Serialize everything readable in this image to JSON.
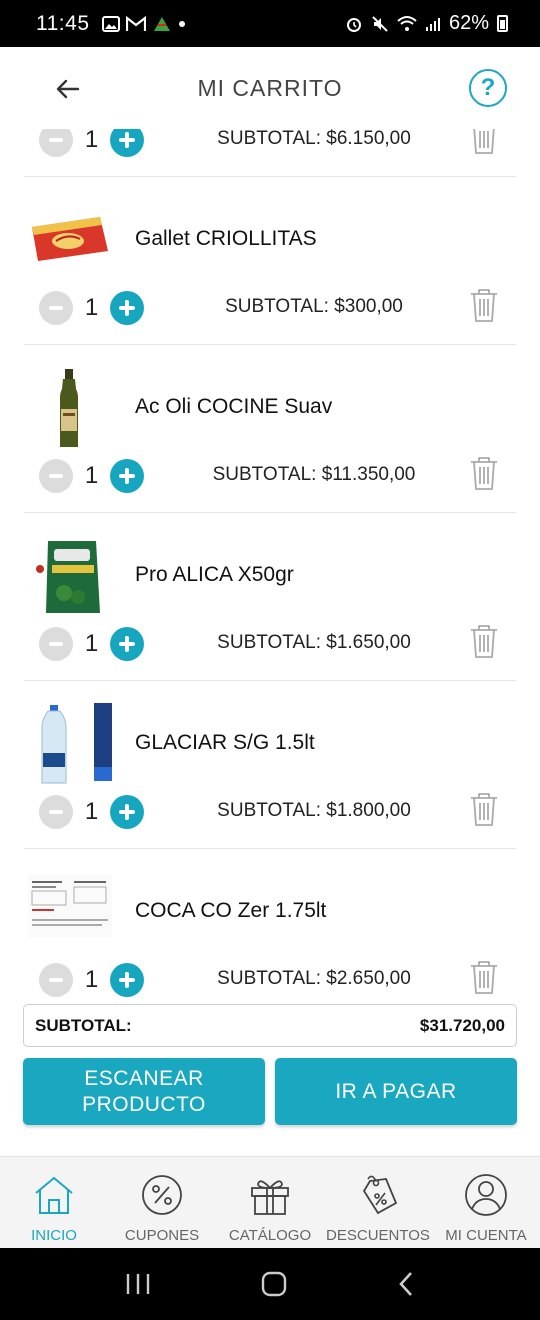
{
  "status_bar": {
    "time": "11:45",
    "battery": "62%"
  },
  "header": {
    "title": "MI CARRITO",
    "help": "?"
  },
  "cart": {
    "items": [
      {
        "name": "",
        "qty": "1",
        "subtotal": "SUBTOTAL: $6.150,00"
      },
      {
        "name": "Gallet CRIOLLITAS",
        "qty": "1",
        "subtotal": "SUBTOTAL: $300,00"
      },
      {
        "name": "Ac Oli COCINE Suav",
        "qty": "1",
        "subtotal": "SUBTOTAL: $11.350,00"
      },
      {
        "name": "Pro ALICA X50gr",
        "qty": "1",
        "subtotal": "SUBTOTAL: $1.650,00"
      },
      {
        "name": "GLACIAR S/G 1.5lt",
        "qty": "1",
        "subtotal": "SUBTOTAL: $1.800,00"
      },
      {
        "name": "COCA CO Zer 1.75lt",
        "qty": "1",
        "subtotal": "SUBTOTAL: $2.650,00"
      }
    ]
  },
  "totals": {
    "label": "SUBTOTAL:",
    "value": "$31.720,00"
  },
  "actions": {
    "scan": "ESCANEAR PRODUCTO",
    "pay": "IR A PAGAR"
  },
  "nav": {
    "items": [
      {
        "label": "INICIO",
        "icon": "home-icon",
        "active": true
      },
      {
        "label": "CUPONES",
        "icon": "percent-icon"
      },
      {
        "label": "CATÁLOGO",
        "icon": "gift-icon"
      },
      {
        "label": "DESCUENTOS",
        "icon": "tag-icon"
      },
      {
        "label": "MI CUENTA",
        "icon": "user-icon"
      }
    ]
  },
  "colors": {
    "accent": "#1aa8c0",
    "minus": "#dcdcdc"
  }
}
